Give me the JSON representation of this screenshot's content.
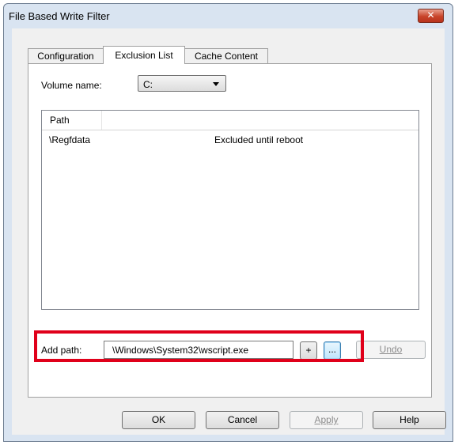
{
  "window": {
    "title": "File Based Write Filter",
    "close_glyph": "✕"
  },
  "tabs": [
    {
      "label": "Configuration"
    },
    {
      "label": "Exclusion List"
    },
    {
      "label": "Cache Content"
    }
  ],
  "volume": {
    "label": "Volume name:",
    "selected": "C:"
  },
  "listview": {
    "columns": [
      "Path"
    ],
    "rows": [
      {
        "path": "\\Regfdata",
        "status": "Excluded until reboot"
      }
    ]
  },
  "add_path": {
    "label": "Add path:",
    "value": "\\Windows\\System32\\wscript.exe",
    "add_label": "+",
    "browse_label": "...",
    "undo_label": "Undo"
  },
  "dialog_buttons": {
    "ok": "OK",
    "cancel": "Cancel",
    "apply": "Apply",
    "help": "Help"
  },
  "colors": {
    "highlight": "#e0001a",
    "close_button": "#c8442a"
  }
}
